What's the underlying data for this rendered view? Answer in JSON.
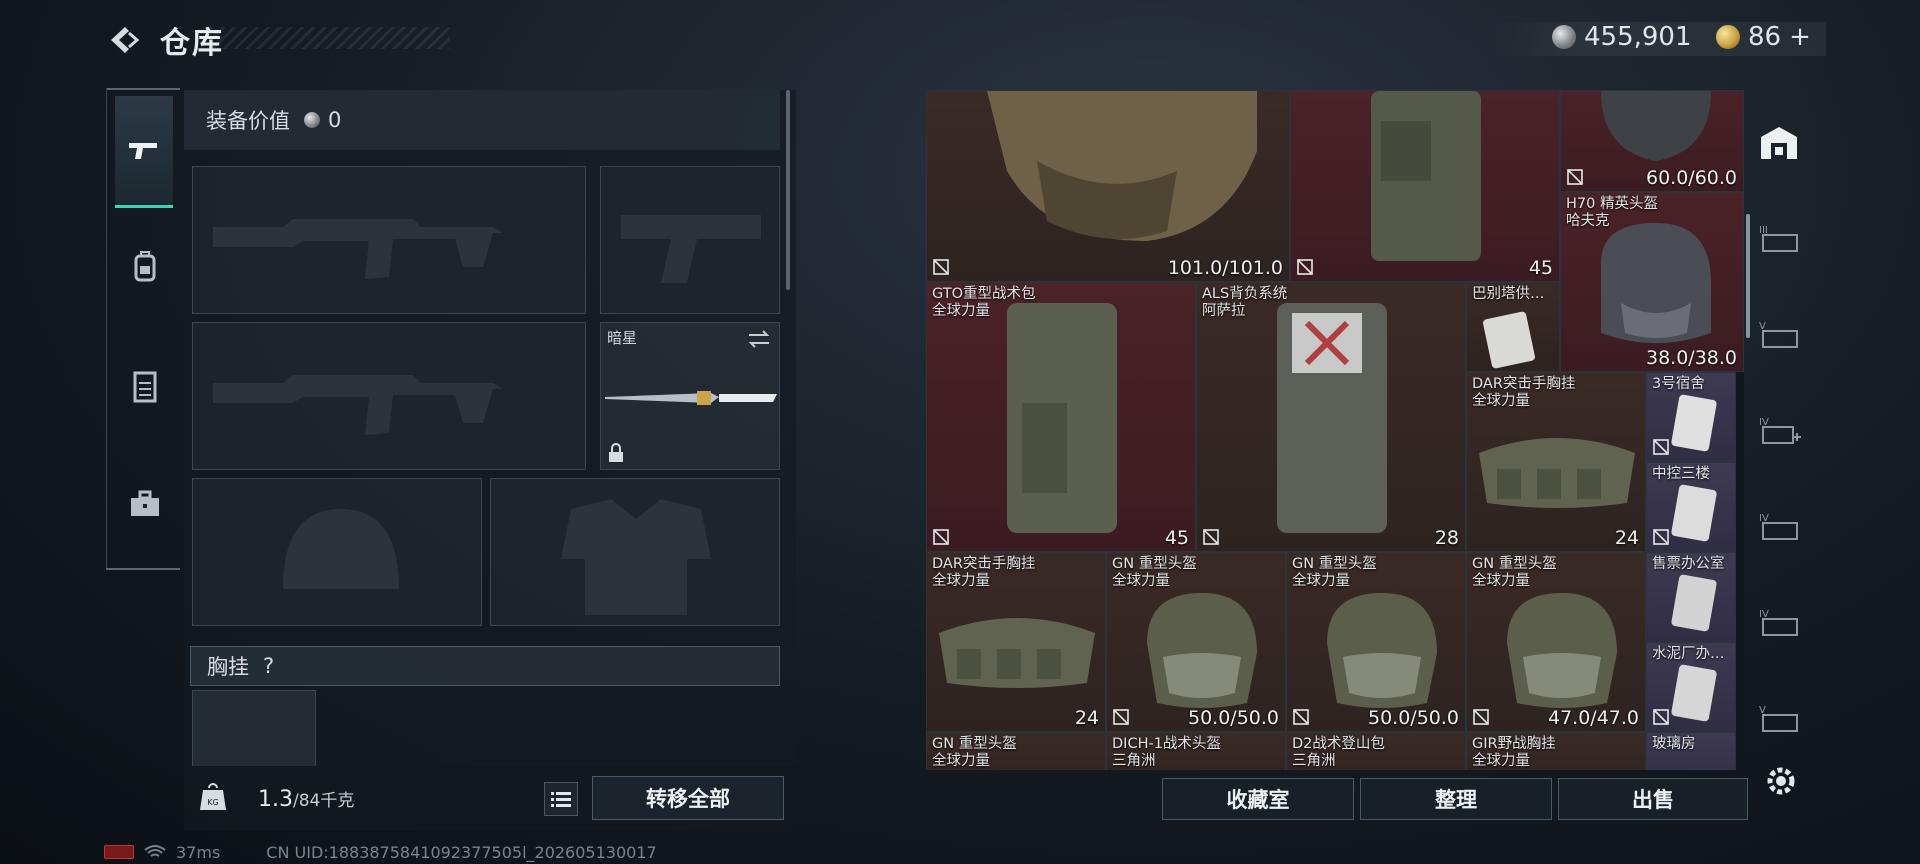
{
  "header": {
    "title": "仓库",
    "silver": "455,901",
    "gold": "86",
    "gold_plus": "+"
  },
  "left": {
    "equip_value_label": "装备价值",
    "equip_value": "0",
    "melee_name": "暗星",
    "chest_label": "胸挂",
    "chest_help": "?",
    "weight_current": "1.3",
    "weight_max": "/84千克",
    "transfer_all": "转移全部"
  },
  "grid": {
    "items": [
      {
        "name": "",
        "value": "101.0/101.0"
      },
      {
        "name": "",
        "value": "45"
      },
      {
        "name": "",
        "value": "60.0/60.0"
      },
      {
        "name": "H70 精英头盔\n哈夫克",
        "value": "38.0/38.0"
      },
      {
        "name": "GTO重型战术包\n全球力量",
        "value": "45"
      },
      {
        "name": "ALS背负系统\n阿萨拉",
        "value": "28"
      },
      {
        "name": "巴别塔供…",
        "value": ""
      },
      {
        "name": "DAR突击手胸挂\n全球力量",
        "value": "24"
      },
      {
        "name": "3号宿舍",
        "value": ""
      },
      {
        "name": "中控三楼",
        "value": ""
      },
      {
        "name": "DAR突击手胸挂\n全球力量",
        "value": "24"
      },
      {
        "name": "GN 重型头盔\n全球力量",
        "value": "50.0/50.0"
      },
      {
        "name": "GN 重型头盔\n全球力量",
        "value": "50.0/50.0"
      },
      {
        "name": "GN 重型头盔\n全球力量",
        "value": "47.0/47.0"
      },
      {
        "name": "售票办公室",
        "value": ""
      },
      {
        "name": "水泥厂办…",
        "value": ""
      },
      {
        "name": "GN 重型头盔\n全球力量",
        "value": ""
      },
      {
        "name": "DICH-1战术头盔\n三角洲",
        "value": ""
      },
      {
        "name": "D2战术登山包\n三角洲",
        "value": ""
      },
      {
        "name": "GIR野战胸挂\n全球力量",
        "value": ""
      },
      {
        "name": "玻璃房",
        "value": ""
      }
    ]
  },
  "buttons": {
    "collection": "收藏室",
    "organize": "整理",
    "sell": "出售"
  },
  "status": {
    "ping": "37ms",
    "uid": "CN UID:1883875841092377505l_202605130017"
  },
  "colors": {
    "accent": "#3fd5b2",
    "rare_red": "#4a2228",
    "epic_purple": "#3d3a52"
  }
}
